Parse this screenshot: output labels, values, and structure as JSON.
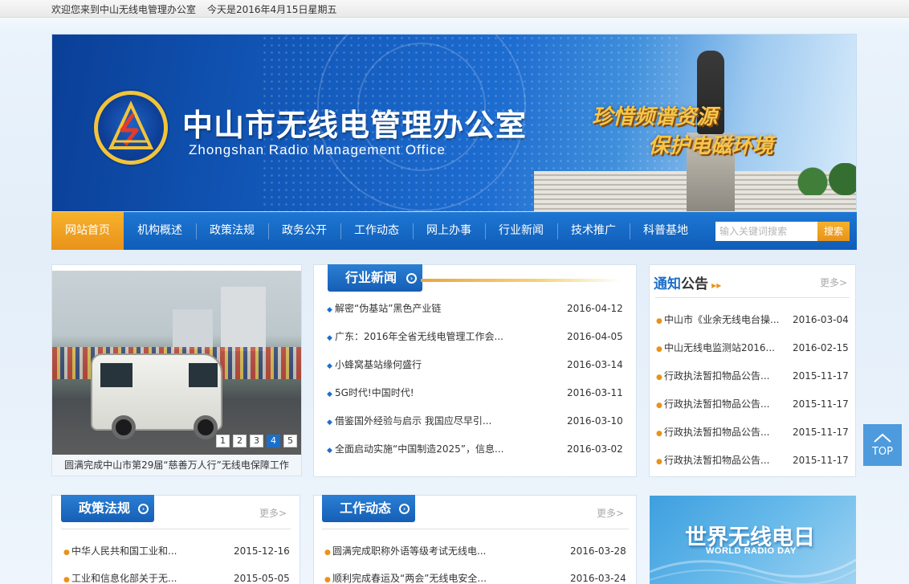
{
  "topbar": {
    "welcome": "欢迎您来到中山无线电管理办公室",
    "date": "今天是2016年4月15日星期五"
  },
  "banner": {
    "title": "中山市无线电管理办公室",
    "subtitle": "Zhongshan  Radio Management Office",
    "slogan_1": "珍惜频谱资源",
    "slogan_2": "保护电磁环境"
  },
  "nav": {
    "items": [
      "网站首页",
      "机构概述",
      "政策法规",
      "政务公开",
      "工作动态",
      "网上办事",
      "行业新闻",
      "技术推广",
      "科普基地"
    ],
    "active_index": 0
  },
  "search": {
    "placeholder": "输入关键词搜索",
    "button": "搜索"
  },
  "slideshow": {
    "caption": "圆满完成中山市第29届“慈善万人行”无线电保障工作",
    "pages": [
      "1",
      "2",
      "3",
      "4",
      "5"
    ],
    "current": 4
  },
  "industry_news": {
    "title": "行业新闻",
    "items": [
      {
        "text": "解密“伪基站”黑色产业链",
        "date": "2016-04-12"
      },
      {
        "text": "广东：2016年全省无线电管理工作会...",
        "date": "2016-04-05"
      },
      {
        "text": "小蜂窝基站缘何盛行",
        "date": "2016-03-14"
      },
      {
        "text": "5G时代!中国时代!",
        "date": "2016-03-11"
      },
      {
        "text": "借鉴国外经验与启示 我国应尽早引...",
        "date": "2016-03-10"
      },
      {
        "text": "全面启动实施“中国制造2025”，信息...",
        "date": "2016-03-02"
      }
    ]
  },
  "notices": {
    "title_a": "通知",
    "title_b": "公告",
    "more": "更多>",
    "items": [
      {
        "text": "中山市《业余无线电台操...",
        "date": "2016-03-04"
      },
      {
        "text": "中山无线电监测站2016...",
        "date": "2016-02-15"
      },
      {
        "text": "行政执法暂扣物品公告...",
        "date": "2015-11-17"
      },
      {
        "text": "行政执法暂扣物品公告...",
        "date": "2015-11-17"
      },
      {
        "text": "行政执法暂扣物品公告...",
        "date": "2015-11-17"
      },
      {
        "text": "行政执法暂扣物品公告...",
        "date": "2015-11-17"
      }
    ]
  },
  "policy": {
    "title": "政策法规",
    "more": "更多>",
    "items": [
      {
        "text": "中华人民共和国工业和...",
        "date": "2015-12-16"
      },
      {
        "text": "工业和信息化部关于无...",
        "date": "2015-05-05"
      }
    ]
  },
  "work": {
    "title": "工作动态",
    "more": "更多>",
    "items": [
      {
        "text": "圆满完成职称外语等级考试无线电...",
        "date": "2016-03-28"
      },
      {
        "text": "顺利完成春运及“两会”无线电安全...",
        "date": "2016-03-24"
      }
    ]
  },
  "world_radio_day": {
    "title": "世界无线电日",
    "subtitle": "WORLD RADIO DAY"
  },
  "top_button": {
    "label": "TOP"
  },
  "colors": {
    "primary": "#1b6fc9",
    "accent": "#e9921a",
    "gold": "#f7c64a"
  }
}
